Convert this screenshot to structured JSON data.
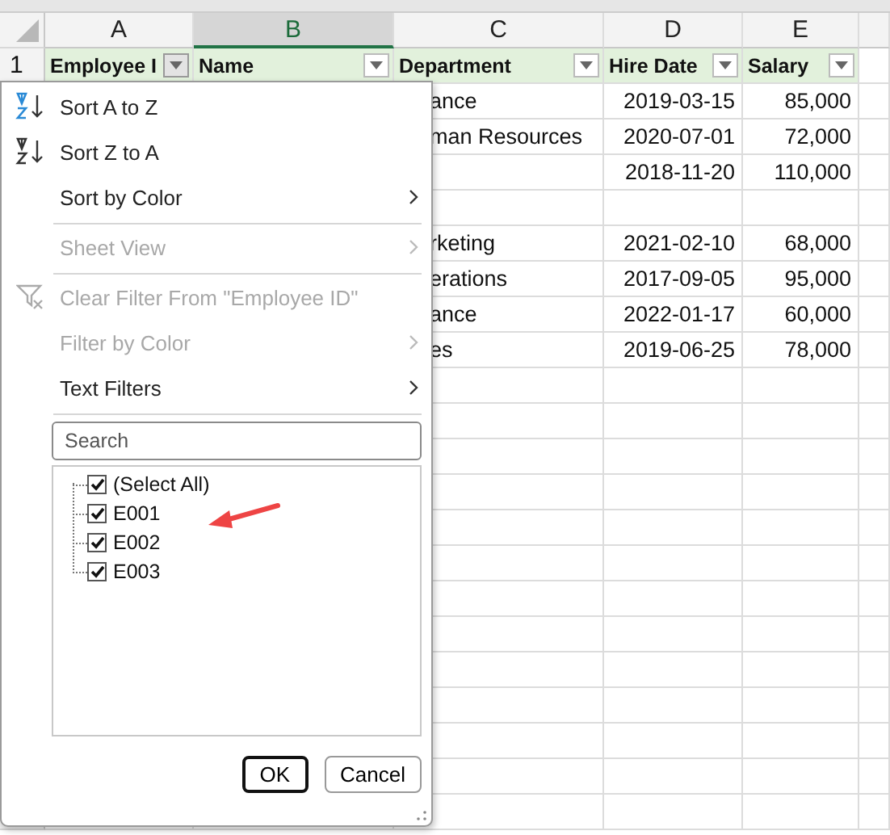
{
  "columns": [
    {
      "label": "A",
      "selected": false
    },
    {
      "label": "B",
      "selected": true
    },
    {
      "label": "C",
      "selected": false
    },
    {
      "label": "D",
      "selected": false
    },
    {
      "label": "E",
      "selected": false
    }
  ],
  "row_number": "1",
  "header": [
    {
      "label": "Employee I",
      "filter_open": true
    },
    {
      "label": "Name",
      "filter_open": false
    },
    {
      "label": "Department",
      "filter_open": false
    },
    {
      "label": "Hire Date",
      "filter_open": false
    },
    {
      "label": "Salary",
      "filter_open": false
    }
  ],
  "rows": [
    {
      "department": "ance",
      "hire_date": "2019-03-15",
      "salary": "85,000"
    },
    {
      "department": "man Resources",
      "hire_date": "2020-07-01",
      "salary": "72,000"
    },
    {
      "hire_date": "2018-11-20",
      "salary": "110,000"
    },
    {},
    {
      "department": "rketing",
      "hire_date": "2021-02-10",
      "salary": "68,000"
    },
    {
      "department": "erations",
      "hire_date": "2017-09-05",
      "salary": "95,000"
    },
    {
      "department": "ance",
      "hire_date": "2022-01-17",
      "salary": "60,000"
    },
    {
      "department": "es",
      "hire_date": "2019-06-25",
      "salary": "78,000"
    }
  ],
  "filter_menu": {
    "items": [
      {
        "kind": "sort_az",
        "label": "Sort A to Z",
        "disabled": false,
        "submenu": false,
        "divider_after": false
      },
      {
        "kind": "sort_za",
        "label": "Sort Z to A",
        "disabled": false,
        "submenu": false,
        "divider_after": false
      },
      {
        "kind": "plain",
        "label": "Sort by Color",
        "disabled": false,
        "submenu": true,
        "divider_after": true
      },
      {
        "kind": "plain",
        "label": "Sheet View",
        "disabled": true,
        "submenu": true,
        "divider_after": true
      },
      {
        "kind": "clear_filter",
        "label": "Clear Filter From \"Employee ID\"",
        "disabled": true,
        "submenu": false,
        "divider_after": false
      },
      {
        "kind": "plain",
        "label": "Filter by Color",
        "disabled": true,
        "submenu": true,
        "divider_after": false
      },
      {
        "kind": "plain",
        "label": "Text Filters",
        "disabled": false,
        "submenu": true,
        "divider_after": true
      }
    ],
    "search": {
      "placeholder": "Search"
    },
    "values": [
      {
        "label": "(Select All)",
        "checked": true
      },
      {
        "label": "E001",
        "checked": true
      },
      {
        "label": "E002",
        "checked": true
      },
      {
        "label": "E003",
        "checked": true
      }
    ],
    "buttons": [
      {
        "label": "OK",
        "default": true
      },
      {
        "label": "Cancel",
        "default": false
      }
    ]
  }
}
